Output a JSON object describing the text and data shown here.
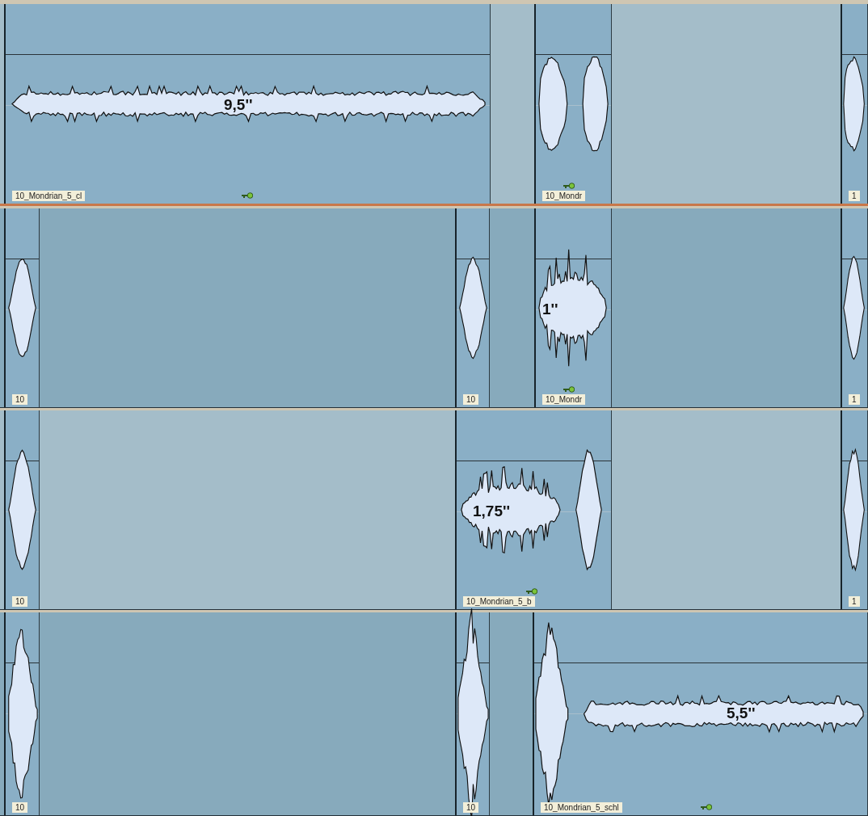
{
  "lanes": [
    {
      "selected": true,
      "clips": [
        {
          "label": "10_Mondrian_5_cl",
          "duration": "9,5''",
          "locked": true
        },
        {
          "label": "10_Mondr",
          "locked": true
        },
        {
          "label": "1",
          "locked": false
        }
      ]
    },
    {
      "selected": false,
      "clips": [
        {
          "label": "10",
          "locked": false
        },
        {
          "label": "10",
          "locked": false
        },
        {
          "label": "10_Mondr",
          "duration": "1''",
          "locked": true
        },
        {
          "label": "1",
          "locked": false
        }
      ]
    },
    {
      "selected": false,
      "clips": [
        {
          "label": "10",
          "locked": false
        },
        {
          "label": "10_Mondrian_5_b",
          "duration": "1,75''",
          "locked": true
        },
        {
          "label": "1",
          "locked": false
        }
      ]
    },
    {
      "selected": false,
      "clips": [
        {
          "label": "10",
          "locked": false
        },
        {
          "label": "10",
          "locked": false
        },
        {
          "label": "10_Mondrian_5_schl",
          "duration": "5,5''",
          "locked": true
        }
      ]
    }
  ]
}
